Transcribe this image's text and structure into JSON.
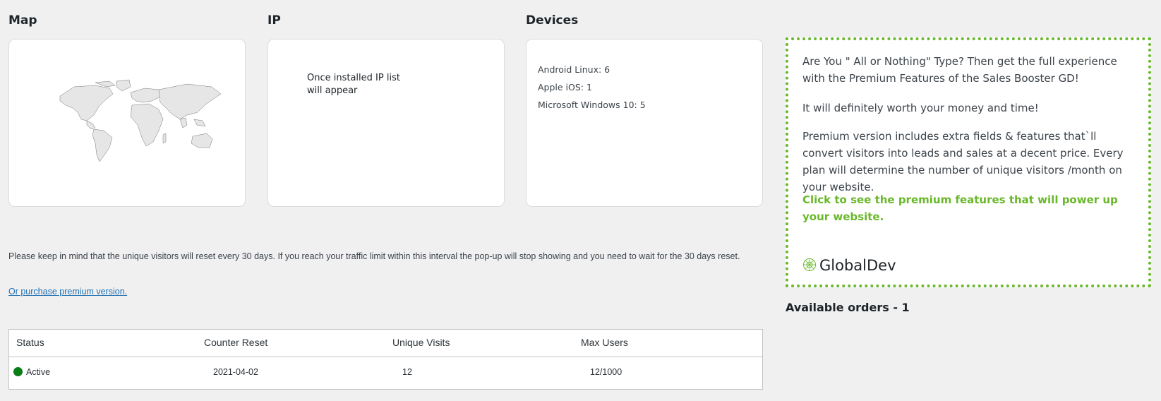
{
  "sections": {
    "map_title": "Map",
    "ip_title": "IP",
    "devices_title": "Devices"
  },
  "ip": {
    "empty_message": "Once installed IP list will appear"
  },
  "devices": [
    {
      "label": "Android Linux: 6"
    },
    {
      "label": "Apple iOS: 1"
    },
    {
      "label": "Microsoft Windows 10: 5"
    }
  ],
  "note": "Please keep in mind that the unique visitors will reset every 30 days. If you reach your traffic limit within this interval the pop-up will stop showing and you need to wait for the 30 days reset.",
  "purchase_link": "Or purchase premium version.",
  "table": {
    "headers": {
      "status": "Status",
      "counter_reset": "Counter Reset",
      "unique_visits": "Unique Visits",
      "max_users": "Max Users"
    },
    "row": {
      "status": "Active",
      "counter_reset": "2021-04-02",
      "unique_visits": "12",
      "max_users": "12/1000"
    },
    "status_color": "#0a7d14"
  },
  "promo": {
    "p1": "Are You \" All or Nothing\" Type? Then get the full experience with the Premium Features of the Sales Booster GD!",
    "p2": "It will definitely worth your money and time!",
    "p3": "Premium version includes extra fields & features that`ll convert visitors into leads and sales at a decent price. Every plan will determine the number of unique visitors /month on your website.",
    "cta": "Click to see the premium features that will power up your website.",
    "brand": "GlobalDev",
    "accent_color": "#69b82a"
  },
  "orders": "Available orders - 1"
}
